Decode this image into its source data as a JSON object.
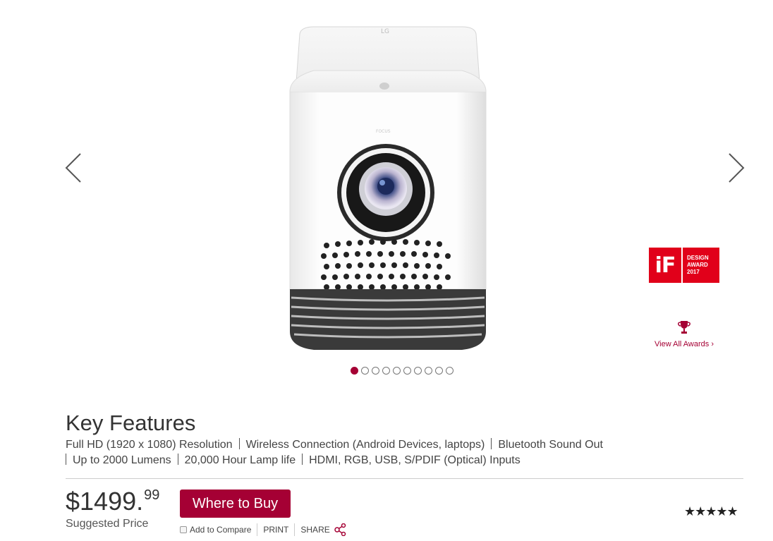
{
  "gallery": {
    "prev_icon": "chevron-left-icon",
    "next_icon": "chevron-right-icon",
    "product_brand_mark": "LG",
    "product_focus_label": "FOCUS",
    "dot_count": 10,
    "active_dot": 0
  },
  "award": {
    "logo_text": "iF",
    "line1": "DESIGN",
    "line2": "AWARD",
    "line3": "2017",
    "view_all": "View All Awards ›",
    "icon": "trophy-icon"
  },
  "features": {
    "title": "Key Features",
    "items": [
      "Full HD (1920 x 1080) Resolution",
      "Wireless Connection (Android Devices, laptops)",
      "Bluetooth Sound Out",
      "Up to 2000 Lumens",
      "20,000 Hour Lamp life",
      "HDMI, RGB, USB, S/PDIF (Optical) Inputs"
    ]
  },
  "pricing": {
    "dollars": "$1499.",
    "cents": "99",
    "label": "Suggested Price",
    "where_to_buy": "Where to Buy"
  },
  "actions": {
    "compare": "Add to Compare",
    "print": "PRINT",
    "share": "SHARE",
    "share_icon": "share-icon"
  },
  "rating": {
    "stars": "★★★★★",
    "value": 5,
    "max": 5
  },
  "colors": {
    "accent": "#a50034",
    "award_red": "#e1001a"
  }
}
